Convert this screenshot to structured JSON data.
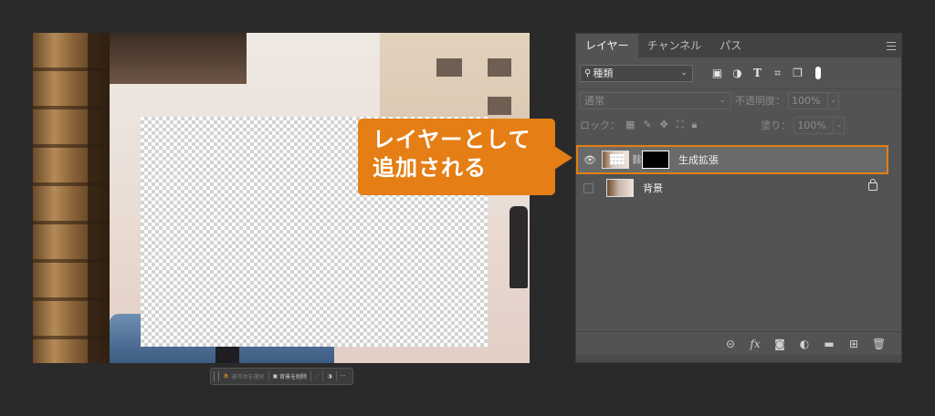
{
  "callout": {
    "line1": "レイヤーとして",
    "line2": "追加される",
    "color": "#e57e14"
  },
  "taskbar": {
    "select_subject": "被写体を選択",
    "remove_background": "背景を削除",
    "more": "···"
  },
  "layers_panel": {
    "tabs": [
      {
        "label": "レイヤー",
        "active": true
      },
      {
        "label": "チャンネル",
        "active": false
      },
      {
        "label": "パス",
        "active": false
      }
    ],
    "filter_kind": "種類",
    "blend_mode": "通常",
    "opacity_label": "不透明度：",
    "opacity_value": "100%",
    "lock_label": "ロック：",
    "fill_label": "塗り：",
    "fill_value": "100%",
    "layers": [
      {
        "name": "生成拡張",
        "selected": true,
        "visible": true,
        "has_mask": true
      },
      {
        "name": "背景",
        "selected": false,
        "visible": false,
        "locked": true
      }
    ],
    "bottom_icons": [
      "link-icon",
      "fx-icon",
      "add-mask-icon",
      "adjustment-icon",
      "group-folder-icon",
      "new-layer-icon",
      "trash-icon"
    ],
    "fx_label": "fx"
  },
  "accent_color": "#e57e14"
}
